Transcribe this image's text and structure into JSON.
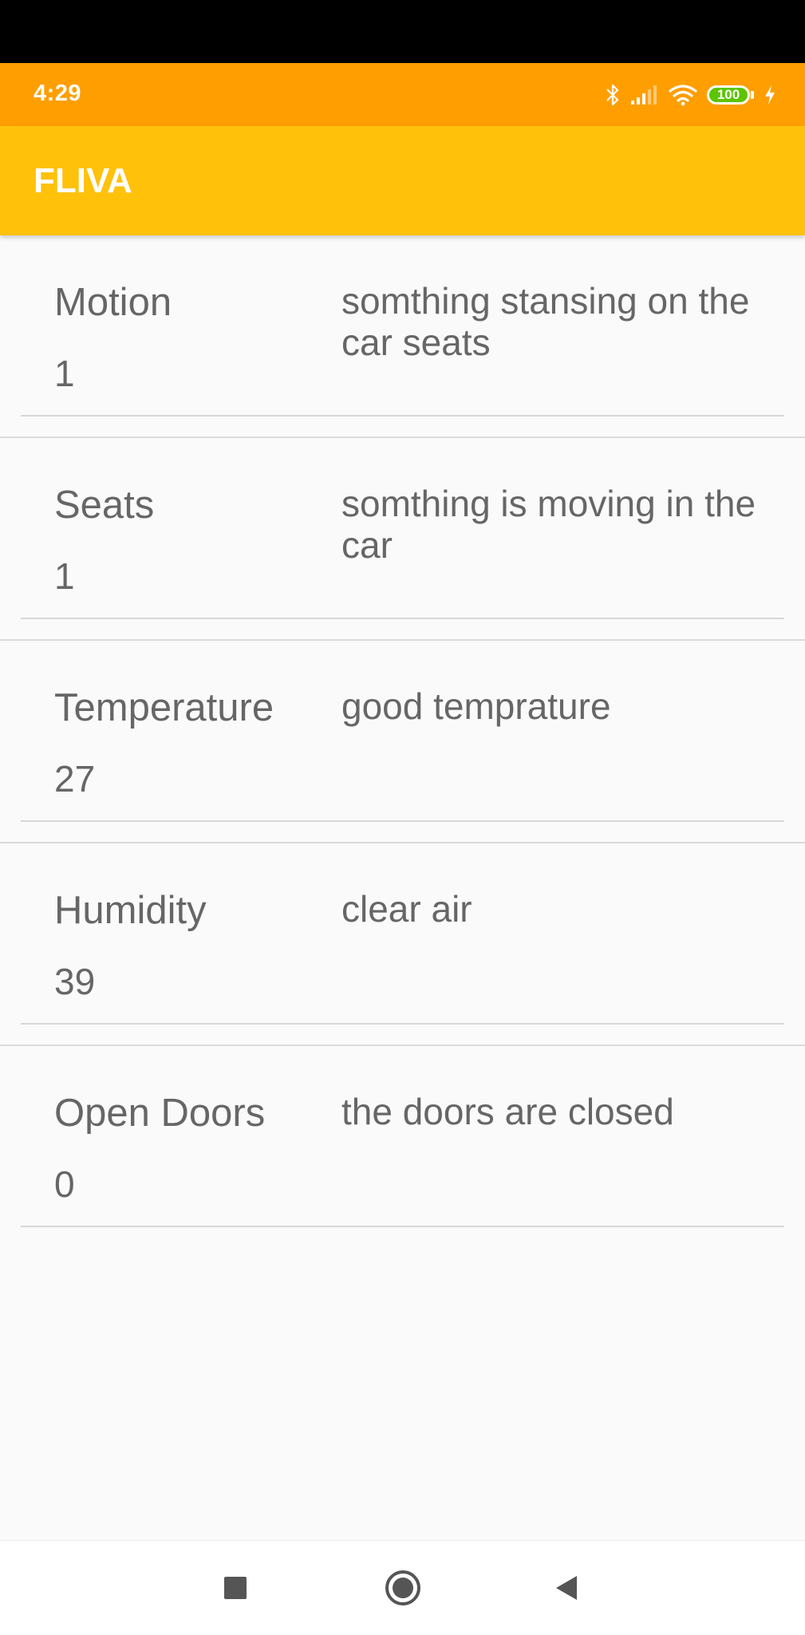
{
  "status_bar": {
    "time": "4:29",
    "battery_level": "100",
    "icons": [
      "bluetooth-icon",
      "signal-icon",
      "wifi-icon",
      "battery-icon",
      "charging-icon"
    ]
  },
  "app_bar": {
    "title": "FLIVA",
    "color": "#ffc10a"
  },
  "sensors": [
    {
      "name": "Motion",
      "value": "1",
      "description": "somthing stansing on the car seats"
    },
    {
      "name": "Seats",
      "value": "1",
      "description": "somthing is moving in the car"
    },
    {
      "name": "Temperature",
      "value": "27",
      "description": "good temprature"
    },
    {
      "name": "Humidity",
      "value": "39",
      "description": "clear air"
    },
    {
      "name": "Open Doors",
      "value": "0",
      "description": "the doors are closed"
    }
  ],
  "nav_bar": {
    "icons": [
      "recents-icon",
      "home-icon",
      "back-icon"
    ]
  },
  "colors": {
    "status_bar": "#ff9e00",
    "app_bar": "#ffc10a",
    "background": "#fafafa",
    "text": "#666666"
  }
}
